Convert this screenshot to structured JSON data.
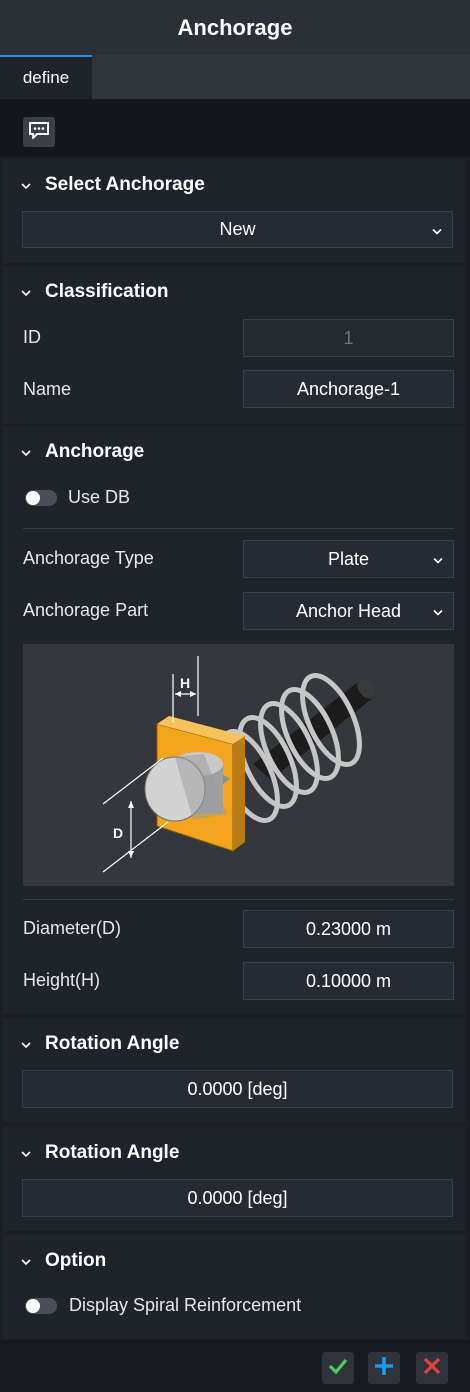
{
  "window": {
    "title": "Anchorage"
  },
  "tabs": [
    {
      "label": "define",
      "active": true
    }
  ],
  "toolbar": {
    "memo_icon": "message-icon"
  },
  "select_anchorage": {
    "title": "Select Anchorage",
    "selected": "New"
  },
  "classification": {
    "title": "Classification",
    "id_label": "ID",
    "id_value": "1",
    "name_label": "Name",
    "name_value": "Anchorage-1"
  },
  "anchorage": {
    "title": "Anchorage",
    "use_db_label": "Use DB",
    "use_db_on": false,
    "type_label": "Anchorage Type",
    "type_value": "Plate",
    "part_label": "Anchorage Part",
    "part_value": "Anchor Head",
    "figure": {
      "h_label": "H",
      "d_label": "D",
      "plate_color": "#f2a51d"
    },
    "diameter_label": "Diameter(D)",
    "diameter_value": "0.23000 m",
    "height_label": "Height(H)",
    "height_value": "0.10000 m"
  },
  "rotation_1": {
    "title": "Rotation Angle",
    "value": "0.0000 [deg]"
  },
  "rotation_2": {
    "title": "Rotation Angle",
    "value": "0.0000 [deg]"
  },
  "option": {
    "title": "Option",
    "spiral_label": "Display Spiral Reinforcement",
    "spiral_on": false
  },
  "footer": {
    "ok_icon": "check-icon",
    "add_icon": "plus-icon",
    "cancel_icon": "close-icon",
    "colors": {
      "ok": "#4ccd5b",
      "add": "#1e9df0",
      "cancel": "#e8413b"
    }
  }
}
